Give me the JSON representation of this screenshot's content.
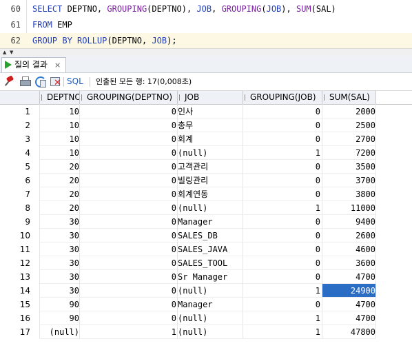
{
  "editor": {
    "lines": [
      {
        "no": "60",
        "tokens": [
          {
            "t": "SELECT ",
            "c": "kw"
          },
          {
            "t": "DEPTNO, ",
            "c": ""
          },
          {
            "t": "GROUPING",
            "c": "fn"
          },
          {
            "t": "(DEPTNO), ",
            "c": ""
          },
          {
            "t": "JOB",
            "c": "kw"
          },
          {
            "t": ", ",
            "c": ""
          },
          {
            "t": "GROUPING",
            "c": "fn"
          },
          {
            "t": "(",
            "c": ""
          },
          {
            "t": "JOB",
            "c": "kw"
          },
          {
            "t": "), ",
            "c": ""
          },
          {
            "t": "SUM",
            "c": "fn"
          },
          {
            "t": "(SAL)",
            "c": ""
          }
        ]
      },
      {
        "no": "61",
        "tokens": [
          {
            "t": "FROM ",
            "c": "kw"
          },
          {
            "t": "EMP",
            "c": ""
          }
        ]
      },
      {
        "no": "62",
        "tokens": [
          {
            "t": "GROUP BY ROLLUP",
            "c": "kw"
          },
          {
            "t": "(DEPTNO, ",
            "c": ""
          },
          {
            "t": "JOB",
            "c": "kw"
          },
          {
            "t": ");",
            "c": ""
          }
        ]
      }
    ]
  },
  "results_tab": {
    "label": "질의 결과",
    "close": "×"
  },
  "toolbar": {
    "sql_label": "SQL",
    "status": "인출된 모든 행: 17(0,008초)"
  },
  "grid": {
    "columns": [
      "DEPTNO",
      "GROUPING(DEPTNO)",
      "JOB",
      "GROUPING(JOB)",
      "SUM(SAL)"
    ],
    "rows": [
      [
        "1",
        "10",
        "0",
        "인사",
        "0",
        "2000"
      ],
      [
        "2",
        "10",
        "0",
        "총무",
        "0",
        "2500"
      ],
      [
        "3",
        "10",
        "0",
        "회계",
        "0",
        "2700"
      ],
      [
        "4",
        "10",
        "0",
        "(null)",
        "1",
        "7200"
      ],
      [
        "5",
        "20",
        "0",
        "고객관리",
        "0",
        "3500"
      ],
      [
        "6",
        "20",
        "0",
        "빌링관리",
        "0",
        "3700"
      ],
      [
        "7",
        "20",
        "0",
        "회계연동",
        "0",
        "3800"
      ],
      [
        "8",
        "20",
        "0",
        "(null)",
        "1",
        "11000"
      ],
      [
        "9",
        "30",
        "0",
        "Manager",
        "0",
        "9400"
      ],
      [
        "10",
        "30",
        "0",
        "SALES_DB",
        "0",
        "2600"
      ],
      [
        "11",
        "30",
        "0",
        "SALES_JAVA",
        "0",
        "4600"
      ],
      [
        "12",
        "30",
        "0",
        "SALES_TOOL",
        "0",
        "3600"
      ],
      [
        "13",
        "30",
        "0",
        "Sr Manager",
        "0",
        "4700"
      ],
      [
        "14",
        "30",
        "0",
        "(null)",
        "1",
        "24900"
      ],
      [
        "15",
        "90",
        "0",
        "Manager",
        "0",
        "4700"
      ],
      [
        "16",
        "90",
        "0",
        "(null)",
        "1",
        "4700"
      ],
      [
        "17",
        "(null)",
        "1",
        "(null)",
        "1",
        "47800"
      ]
    ],
    "selected_cell": {
      "row": 14,
      "column": "SUM(SAL)"
    },
    "selection_color": "#2b6cc4"
  }
}
